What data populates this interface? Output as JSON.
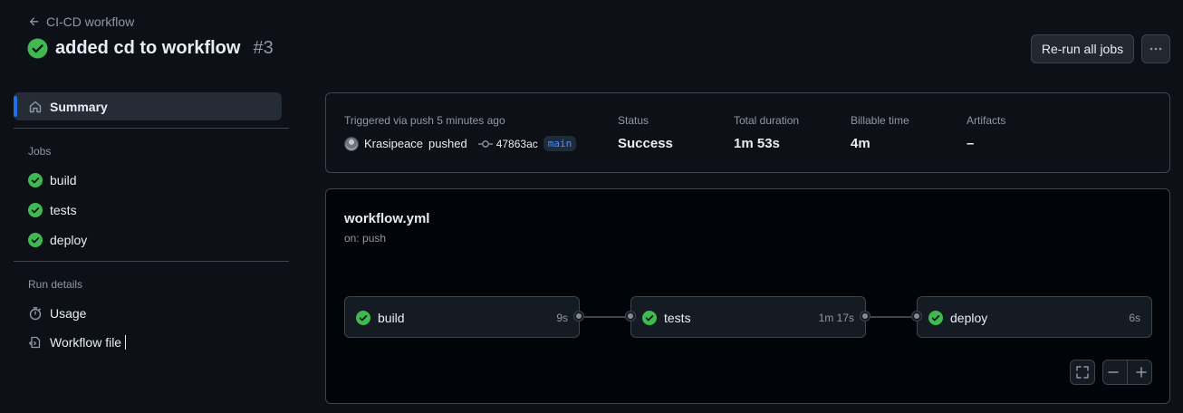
{
  "header": {
    "back_label": "CI-CD workflow",
    "title": "added cd to workflow",
    "run_number": "#3",
    "rerun_label": "Re-run all jobs",
    "more_icon": "kebab-horizontal-icon"
  },
  "sidebar": {
    "summary_label": "Summary",
    "jobs_heading": "Jobs",
    "jobs": [
      {
        "label": "build"
      },
      {
        "label": "tests"
      },
      {
        "label": "deploy"
      }
    ],
    "run_details_heading": "Run details",
    "usage_label": "Usage",
    "workflow_file_label": "Workflow file"
  },
  "summary": {
    "triggered_label": "Triggered via push 5 minutes ago",
    "actor": "Krasipeace",
    "action": "pushed",
    "commit_sha": "47863ac",
    "branch": "main",
    "status_label": "Status",
    "status_value": "Success",
    "duration_label": "Total duration",
    "duration_value": "1m 53s",
    "billable_label": "Billable time",
    "billable_value": "4m",
    "artifacts_label": "Artifacts",
    "artifacts_value": "–"
  },
  "workflow": {
    "file": "workflow.yml",
    "trigger": "on: push",
    "jobs": [
      {
        "name": "build",
        "duration": "9s"
      },
      {
        "name": "tests",
        "duration": "1m 17s"
      },
      {
        "name": "deploy",
        "duration": "6s"
      }
    ]
  },
  "colors": {
    "success": "#3fb950",
    "accent": "#1f6feb",
    "background": "#0d1117"
  }
}
